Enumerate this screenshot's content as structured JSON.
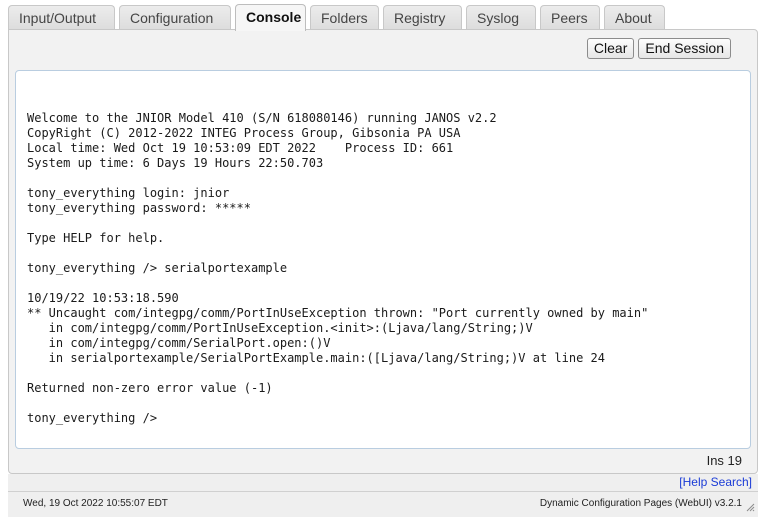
{
  "tabs": [
    {
      "label": "Input/Output",
      "active": false
    },
    {
      "label": "Configuration",
      "active": false
    },
    {
      "label": "Console",
      "active": true
    },
    {
      "label": "Folders",
      "active": false
    },
    {
      "label": "Registry",
      "active": false
    },
    {
      "label": "Syslog",
      "active": false
    },
    {
      "label": "Peers",
      "active": false
    },
    {
      "label": "About",
      "active": false
    }
  ],
  "toolbar": {
    "clear_label": "Clear",
    "end_session_label": "End Session"
  },
  "console": {
    "text": "Welcome to the JNIOR Model 410 (S/N 618080146) running JANOS v2.2\nCopyRight (C) 2012-2022 INTEG Process Group, Gibsonia PA USA\nLocal time: Wed Oct 19 10:53:09 EDT 2022    Process ID: 661\nSystem up time: 6 Days 19 Hours 22:50.703\n\ntony_everything login: jnior\ntony_everything password: *****\n\nType HELP for help.\n\ntony_everything /> serialportexample\n\n10/19/22 10:53:18.590\n** Uncaught com/integpg/comm/PortInUseException thrown: \"Port currently owned by main\"\n   in com/integpg/comm/PortInUseException.<init>:(Ljava/lang/String;)V\n   in com/integpg/comm/SerialPort.open:()V\n   in serialportexample/SerialPortExample.main:([Ljava/lang/String;)V at line 24\n\nReturned non-zero error value (-1)\n\ntony_everything />"
  },
  "status": {
    "ins": "Ins 19"
  },
  "help": {
    "link_label": "[Help Search]"
  },
  "footer": {
    "date": "Wed, 19 Oct 2022 10:55:07 EDT",
    "version": "Dynamic Configuration Pages (WebUI) v3.2.1"
  },
  "icons": {
    "resize": "resize-grip-icon"
  },
  "colors": {
    "link": "#1a3bd6",
    "console_border": "#b9cde0"
  }
}
